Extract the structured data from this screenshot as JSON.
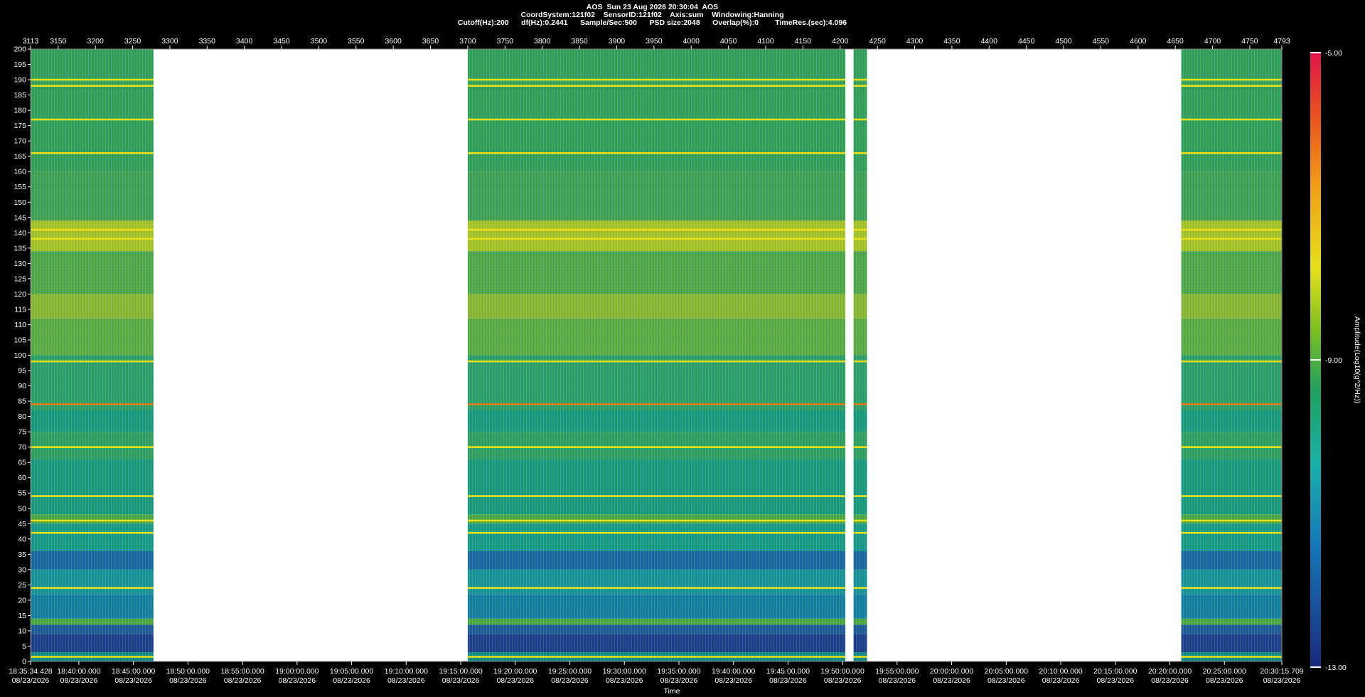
{
  "header": {
    "line1": "AOS  Sun 23 Aug 2026 20:30:04  AOS",
    "line2": "CoordSystem:121f02    SensorID:121f02    Axis:sum    Windowing:Hanning",
    "line3": "Cutoff(Hz):200      df(Hz):0.2441      Sample/Sec:500      PSD size:2048      Overlap(%):0        TimeRes.(sec):4.096"
  },
  "chart_data": {
    "type": "heatmap",
    "title": "AOS  Sun 23 Aug 2026 20:30:04  AOS",
    "xlabel": "Time",
    "ylabel": "",
    "colorbar_label": "Amplitude(Log10(g^2/Hz))",
    "colorbar_ticks": [
      "-5.00",
      "-9.00",
      "-13.00"
    ],
    "clim": [
      -13,
      -5
    ],
    "ylim": [
      0,
      200
    ],
    "y_ticks": [
      0,
      5,
      10,
      15,
      20,
      25,
      30,
      35,
      40,
      45,
      50,
      55,
      60,
      65,
      70,
      75,
      80,
      85,
      90,
      95,
      100,
      105,
      110,
      115,
      120,
      125,
      130,
      135,
      140,
      145,
      150,
      155,
      160,
      165,
      170,
      175,
      180,
      185,
      190,
      195,
      200
    ],
    "top_axis_range": [
      3113,
      4793
    ],
    "top_axis_ticks": [
      "3113",
      "3150",
      "3200",
      "3250",
      "3300",
      "3350",
      "3400",
      "3450",
      "3500",
      "3550",
      "3600",
      "3650",
      "3700",
      "3750",
      "3800",
      "3850",
      "3900",
      "3950",
      "4000",
      "4050",
      "4100",
      "4150",
      "4200",
      "4250",
      "4300",
      "4350",
      "4400",
      "4450",
      "4500",
      "4550",
      "4600",
      "4650",
      "4700",
      "4750",
      "4793"
    ],
    "time_ticks": [
      "18:35:34.428",
      "18:40:00.000",
      "18:45:00.000",
      "18:50:00.000",
      "18:55:00.000",
      "19:00:00.000",
      "19:05:00.000",
      "19:10:00.000",
      "19:15:00.000",
      "19:20:00.000",
      "19:25:00.000",
      "19:30:00.000",
      "19:35:00.000",
      "19:40:00.000",
      "19:45:00.000",
      "19:50:00.000",
      "19:55:00.000",
      "20:00:00.000",
      "20:05:00.000",
      "20:10:00.000",
      "20:15:00.000",
      "20:20:00.000",
      "20:25:00.000",
      "20:30:15.709"
    ],
    "date_label": "08/23/2026",
    "data_segments_top_axis": [
      [
        3113,
        3278
      ],
      [
        3700,
        4207
      ],
      [
        4218,
        4236
      ],
      [
        4658,
        4793
      ]
    ],
    "strong_lines_hz": [
      1.5,
      24,
      42,
      46,
      54,
      70,
      84,
      98,
      138,
      141,
      166,
      177,
      188,
      190
    ],
    "colors": {
      "low": "#1c3f8c",
      "mid": "#149a86",
      "high": "#e6e01c",
      "peak": "#e0144a"
    }
  }
}
